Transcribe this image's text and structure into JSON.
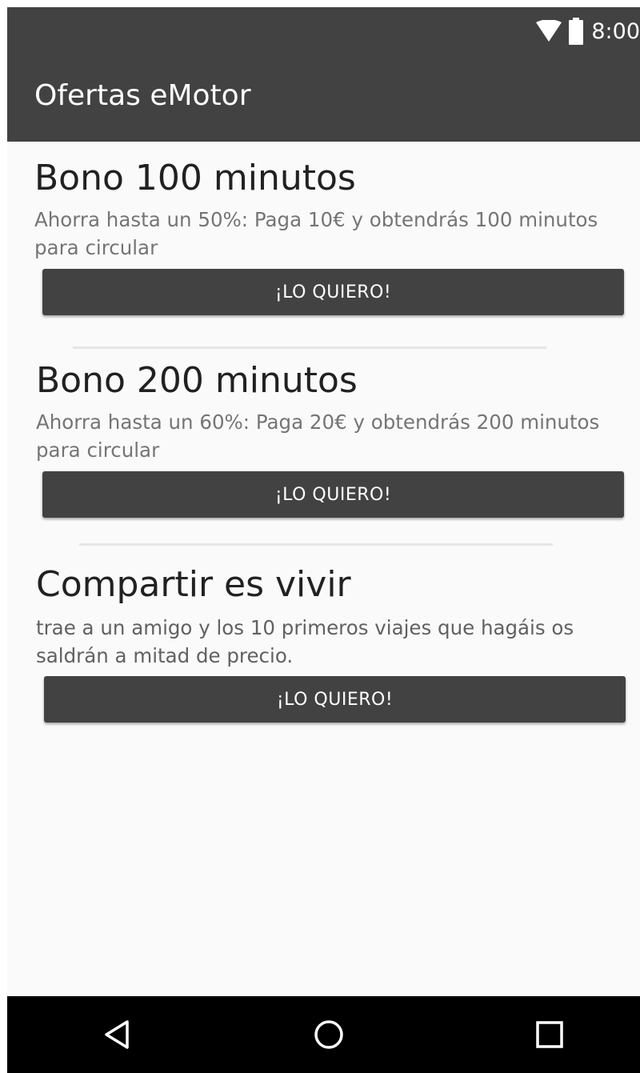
{
  "status_bar": {
    "time": "8:00",
    "icons": [
      "wifi-icon",
      "battery-icon"
    ]
  },
  "app_bar": {
    "title": "Ofertas eMotor"
  },
  "offers": [
    {
      "title": "Bono 100 minutos",
      "description": "Ahorra hasta un 50%: Paga 10€ y obtendrás 100 minutos para circular",
      "button_label": "¡LO QUIERO!"
    },
    {
      "title": "Bono 200 minutos",
      "description": "Ahorra hasta un 60%: Paga 20€ y obtendrás 200 minutos para circular",
      "button_label": "¡LO QUIERO!"
    },
    {
      "title": "Compartir es vivir",
      "description": "trae a un amigo y los 10 primeros viajes que hagáis os saldrán a mitad de precio.",
      "button_label": "¡LO QUIERO!"
    }
  ],
  "nav_bar": {
    "icons": [
      "back-icon",
      "home-icon",
      "recents-icon"
    ]
  },
  "colors": {
    "app_bar": "#424242",
    "background": "#fafafa",
    "button": "#424242",
    "nav_bar": "#000000"
  }
}
